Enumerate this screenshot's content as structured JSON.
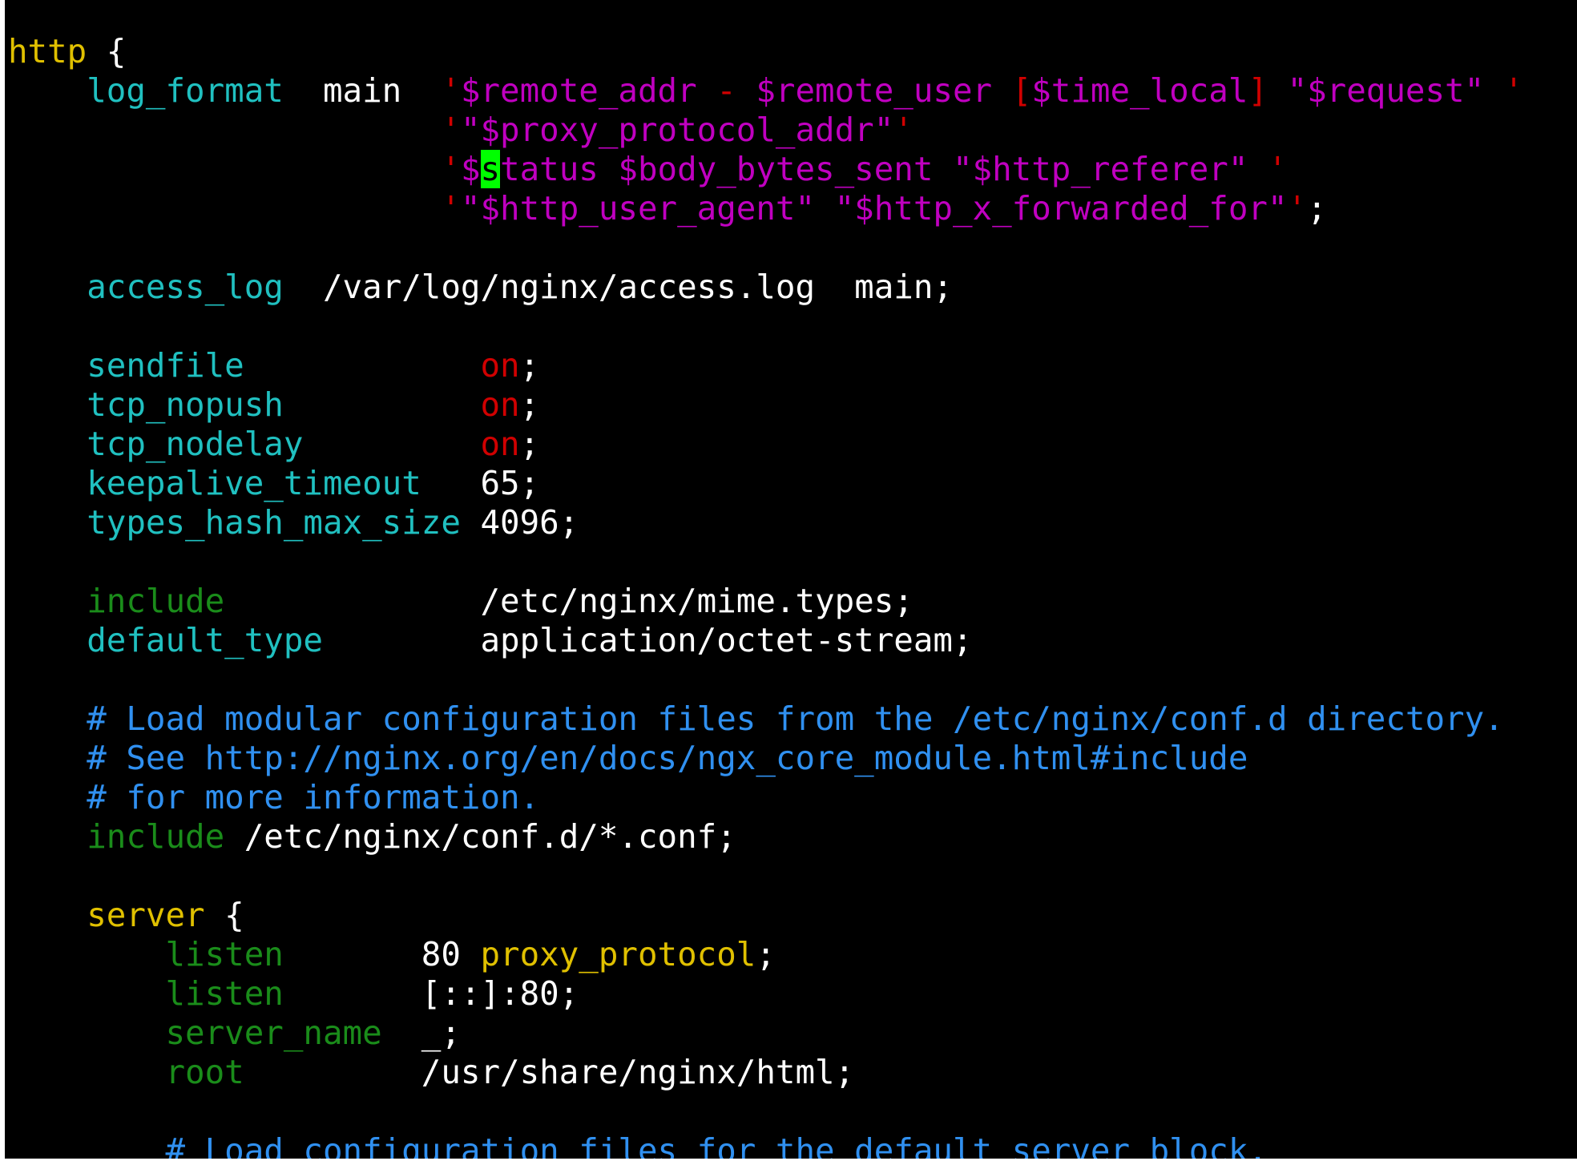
{
  "window": {
    "background": "#000000"
  },
  "colors": {
    "default": "#ffffff",
    "block": "#e0c000",
    "directive": "#20c0c0",
    "string": "#c000c0",
    "string_delim": "#d00000",
    "on": "#d00000",
    "builtin": "#1a8c1a",
    "comment": "#3090f0",
    "cursor_bg": "#00ff00"
  },
  "editor": {
    "cursor": {
      "line": 3,
      "column": 25,
      "char": "s"
    },
    "lines": [
      [
        [
          "block",
          "http"
        ],
        [
          "default",
          " {"
        ]
      ],
      [
        [
          "default",
          "    "
        ],
        [
          "directive",
          "log_format"
        ],
        [
          "default",
          "  main  "
        ],
        [
          "string_delim",
          "'"
        ],
        [
          "string",
          "$remote_addr "
        ],
        [
          "string_delim",
          "- "
        ],
        [
          "string",
          "$remote_user "
        ],
        [
          "string_delim",
          "["
        ],
        [
          "string",
          "$time_local"
        ],
        [
          "string_delim",
          "] "
        ],
        [
          "string",
          "\"$request\" "
        ],
        [
          "string_delim",
          "'"
        ]
      ],
      [
        [
          "default",
          "                      "
        ],
        [
          "string_delim",
          "'"
        ],
        [
          "string",
          "\"$proxy_protocol_addr\""
        ],
        [
          "string_delim",
          "'"
        ]
      ],
      [
        [
          "default",
          "                      "
        ],
        [
          "string_delim",
          "'"
        ],
        [
          "string",
          "$"
        ],
        [
          "cursor",
          "s"
        ],
        [
          "string",
          "tatus $body_bytes_sent \"$http_referer\" "
        ],
        [
          "string_delim",
          "'"
        ]
      ],
      [
        [
          "default",
          "                      "
        ],
        [
          "string_delim",
          "'"
        ],
        [
          "string",
          "\"$http_user_agent\" \"$http_x_forwarded_for\""
        ],
        [
          "string_delim",
          "'"
        ],
        [
          "default",
          ";"
        ]
      ],
      [],
      [
        [
          "default",
          "    "
        ],
        [
          "directive",
          "access_log"
        ],
        [
          "default",
          "  /var/log/nginx/access.log  main;"
        ]
      ],
      [],
      [
        [
          "default",
          "    "
        ],
        [
          "directive",
          "sendfile"
        ],
        [
          "default",
          "            "
        ],
        [
          "on",
          "on"
        ],
        [
          "default",
          ";"
        ]
      ],
      [
        [
          "default",
          "    "
        ],
        [
          "directive",
          "tcp_nopush"
        ],
        [
          "default",
          "          "
        ],
        [
          "on",
          "on"
        ],
        [
          "default",
          ";"
        ]
      ],
      [
        [
          "default",
          "    "
        ],
        [
          "directive",
          "tcp_nodelay"
        ],
        [
          "default",
          "         "
        ],
        [
          "on",
          "on"
        ],
        [
          "default",
          ";"
        ]
      ],
      [
        [
          "default",
          "    "
        ],
        [
          "directive",
          "keepalive_timeout"
        ],
        [
          "default",
          "   65;"
        ]
      ],
      [
        [
          "default",
          "    "
        ],
        [
          "directive",
          "types_hash_max_size"
        ],
        [
          "default",
          " 4096;"
        ]
      ],
      [],
      [
        [
          "default",
          "    "
        ],
        [
          "builtin",
          "include"
        ],
        [
          "default",
          "             /etc/nginx/mime.types;"
        ]
      ],
      [
        [
          "default",
          "    "
        ],
        [
          "directive",
          "default_type"
        ],
        [
          "default",
          "        application/octet-stream;"
        ]
      ],
      [],
      [
        [
          "default",
          "    "
        ],
        [
          "comment",
          "# Load modular configuration files from the /etc/nginx/conf.d directory."
        ]
      ],
      [
        [
          "default",
          "    "
        ],
        [
          "comment",
          "# See http://nginx.org/en/docs/ngx_core_module.html#include"
        ]
      ],
      [
        [
          "default",
          "    "
        ],
        [
          "comment",
          "# for more information."
        ]
      ],
      [
        [
          "default",
          "    "
        ],
        [
          "builtin",
          "include"
        ],
        [
          "default",
          " /etc/nginx/conf.d/*.conf;"
        ]
      ],
      [],
      [
        [
          "default",
          "    "
        ],
        [
          "block",
          "server"
        ],
        [
          "default",
          " {"
        ]
      ],
      [
        [
          "default",
          "        "
        ],
        [
          "builtin",
          "listen"
        ],
        [
          "default",
          "       80 "
        ],
        [
          "block",
          "proxy_protocol"
        ],
        [
          "default",
          ";"
        ]
      ],
      [
        [
          "default",
          "        "
        ],
        [
          "builtin",
          "listen"
        ],
        [
          "default",
          "       [::]:80;"
        ]
      ],
      [
        [
          "default",
          "        "
        ],
        [
          "builtin",
          "server_name"
        ],
        [
          "default",
          "  _;"
        ]
      ],
      [
        [
          "default",
          "        "
        ],
        [
          "builtin",
          "root"
        ],
        [
          "default",
          "         /usr/share/nginx/html;"
        ]
      ],
      [],
      [
        [
          "default",
          "        "
        ],
        [
          "comment",
          "# Load configuration files for the default server block."
        ]
      ]
    ]
  }
}
